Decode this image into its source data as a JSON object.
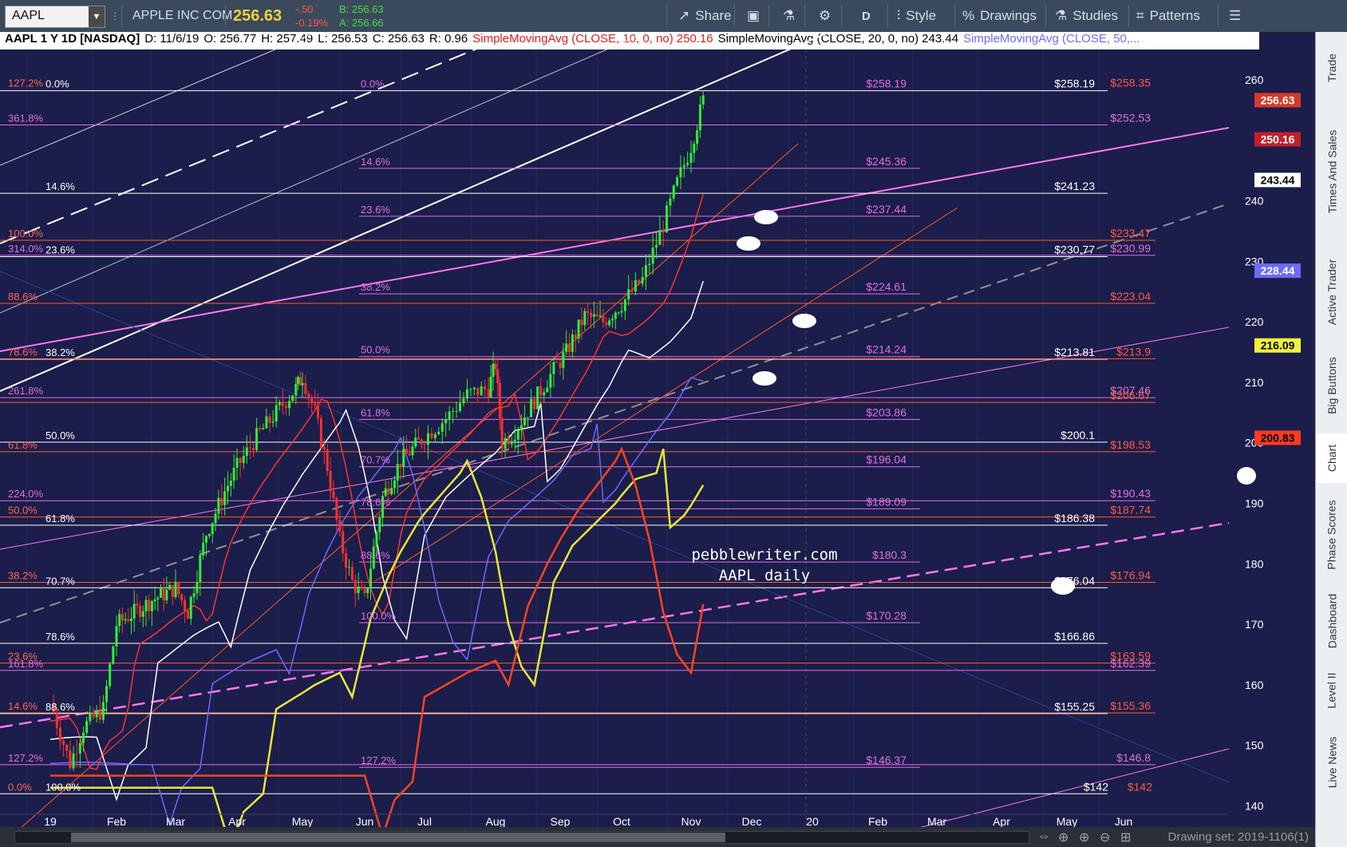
{
  "toolbar": {
    "symbol": "AAPL",
    "company": "APPLE INC COM",
    "last": "256.63",
    "change": "-.50",
    "change_pct": "-0.19%",
    "bid": "B: 256.63",
    "ask": "A: 256.66",
    "share_label": "Share",
    "period_label": "D",
    "style_label": "Style",
    "drawings_label": "Drawings",
    "studies_label": "Studies",
    "patterns_label": "Patterns"
  },
  "header": {
    "title": "AAPL 1 Y 1D [NASDAQ]",
    "date": "D: 11/6/19",
    "open": "O: 256.77",
    "high": "H: 257.49",
    "low": "L: 256.53",
    "close": "C: 256.63",
    "range": "R: 0.96",
    "sma10": "SimpleMovingAvg (CLOSE, 10, 0, no)",
    "sma10_val": "250.16",
    "sma20": "SimpleMovingAvg (CLOSE, 20, 0, no)",
    "sma20_val": "243.44",
    "sma50": "SimpleMovingAvg (CLOSE, 50,...",
    "colors": {
      "sma10": "#ff3333",
      "sma20": "#000000",
      "sma50": "#6b6bff"
    }
  },
  "watermark": [
    "pebblewriter.com",
    "AAPL daily"
  ],
  "right_tabs": [
    "Trade",
    "Times And Sales",
    "Active Trader",
    "Big Buttons",
    "Chart",
    "Phase Scores",
    "Dashboard",
    "Level II",
    "Live News"
  ],
  "active_tab": "Chart",
  "bottom": {
    "drawing_set": "Drawing set: 2019-1106(1)"
  },
  "chart_data": {
    "type": "candlestick",
    "ylim": [
      136.5,
      265
    ],
    "y_ticks": [
      140,
      150,
      160,
      170,
      180,
      190,
      200,
      210,
      220,
      230,
      240,
      260
    ],
    "x_ticks": [
      {
        "label": "19",
        "month": 0
      },
      {
        "label": "Feb",
        "month": 1
      },
      {
        "label": "Mar",
        "month": 2
      },
      {
        "label": "Apr",
        "month": 3
      },
      {
        "label": "May",
        "month": 4
      },
      {
        "label": "Jun",
        "month": 5
      },
      {
        "label": "Jul",
        "month": 6
      },
      {
        "label": "Aug",
        "month": 7
      },
      {
        "label": "Sep",
        "month": 8
      },
      {
        "label": "Oct",
        "month": 9
      },
      {
        "label": "Nov",
        "month": 10
      },
      {
        "label": "Dec",
        "month": 11
      },
      {
        "label": "20",
        "month": 12
      },
      {
        "label": "Feb",
        "month": 13
      },
      {
        "label": "Mar",
        "month": 14
      },
      {
        "label": "Apr",
        "month": 15
      },
      {
        "label": "May",
        "month": 16
      },
      {
        "label": "Jun",
        "month": 17
      }
    ],
    "price_path": [
      [
        0,
        157
      ],
      [
        0.3,
        147
      ],
      [
        0.5,
        153
      ],
      [
        0.8,
        156
      ],
      [
        1.0,
        170
      ],
      [
        1.3,
        172
      ],
      [
        1.6,
        174
      ],
      [
        2.0,
        176
      ],
      [
        2.2,
        172
      ],
      [
        2.5,
        185
      ],
      [
        2.8,
        192
      ],
      [
        3.0,
        196
      ],
      [
        3.3,
        201
      ],
      [
        3.6,
        205
      ],
      [
        3.9,
        209
      ],
      [
        4.0,
        211
      ],
      [
        4.2,
        205
      ],
      [
        4.4,
        196
      ],
      [
        4.6,
        184
      ],
      [
        4.8,
        177
      ],
      [
        5.0,
        174
      ],
      [
        5.3,
        191
      ],
      [
        5.6,
        197
      ],
      [
        6.0,
        201
      ],
      [
        6.3,
        204
      ],
      [
        6.6,
        208
      ],
      [
        6.9,
        209
      ],
      [
        7.0,
        213
      ],
      [
        7.1,
        200
      ],
      [
        7.3,
        202
      ],
      [
        7.6,
        207
      ],
      [
        7.9,
        212
      ],
      [
        8.1,
        215
      ],
      [
        8.4,
        221
      ],
      [
        8.7,
        220
      ],
      [
        9.0,
        223
      ],
      [
        9.3,
        227
      ],
      [
        9.6,
        236
      ],
      [
        9.8,
        243
      ],
      [
        10.0,
        249
      ],
      [
        10.2,
        256.6
      ]
    ],
    "moving_averages": [
      {
        "name": "SimpleMovingAvg (CLOSE, 10, 0, no)",
        "color": "#ff3333",
        "value": 250.16
      },
      {
        "name": "SimpleMovingAvg (CLOSE, 20, 0, no)",
        "color": "#ffffff",
        "value": 243.44
      },
      {
        "name": "SimpleMovingAvg (CLOSE, 50,...",
        "color": "#6b6bff",
        "value": 228.44
      },
      {
        "name": "",
        "color": "#e8e838",
        "value": 216.09
      },
      {
        "name": "",
        "color": "#ff4422",
        "value": 200.83
      }
    ],
    "price_badges": [
      {
        "value": 256.63,
        "label": "256.63",
        "bg": "#d53a2a",
        "fg": "#ffffff"
      },
      {
        "value": 250.16,
        "label": "250.16",
        "bg": "#c4202a",
        "fg": "#ffffff"
      },
      {
        "value": 243.44,
        "label": "243.44",
        "bg": "#ffffff",
        "fg": "#000000"
      },
      {
        "value": 228.44,
        "label": "228.44",
        "bg": "#6b6bff",
        "fg": "#ffffff"
      },
      {
        "value": 216.09,
        "label": "216.09",
        "bg": "#f2f23a",
        "fg": "#000000"
      },
      {
        "value": 200.83,
        "label": "200.83",
        "bg": "#ff3a22",
        "fg": "#000000"
      }
    ],
    "fib_levels": [
      {
        "price": 258.19,
        "color": "#ffffff",
        "x0": 0,
        "x1": 1388,
        "pct": "0.0%",
        "pct_x": 57,
        "right": "$258.19",
        "right_x": 1372
      },
      {
        "price": 258.35,
        "color": "#ffffff",
        "x0": 0,
        "x1": 0,
        "pct": "127.2%",
        "pct_x": 10,
        "pct_color": "#ff6655",
        "right": "$258.35",
        "right_x": 1442,
        "right_color": "#ff5a44"
      },
      {
        "price": 258.19,
        "color": "#e070e0",
        "x0": 0,
        "x1": 0,
        "pct": "0.0%",
        "pct_x": 452,
        "pct_color": "#e070e0",
        "right": "$258.19",
        "right_x": 1136,
        "right_color": "#e070e0"
      },
      {
        "price": 252.53,
        "color": "#e070e0",
        "x0": 0,
        "x1": 1388,
        "pct": "361.8%",
        "pct_x": 10,
        "pct_color": "#e070e0",
        "right": "$252.53",
        "right_x": 1442,
        "right_color": "#e070e0"
      },
      {
        "price": 245.36,
        "color": "#e070e0",
        "x0": 450,
        "x1": 1153,
        "pct": "14.6%",
        "pct_x": 452,
        "pct_color": "#e070e0",
        "right": "$245.36",
        "right_x": 1136,
        "right_color": "#e070e0"
      },
      {
        "price": 241.23,
        "color": "#ffffff",
        "x0": 0,
        "x1": 1388,
        "pct": "14.6%",
        "pct_x": 57,
        "right": "$241.23",
        "right_x": 1372
      },
      {
        "price": 237.44,
        "color": "#e070e0",
        "x0": 450,
        "x1": 1153,
        "pct": "23.6%",
        "pct_x": 452,
        "pct_color": "#e070e0",
        "right": "$237.44",
        "right_x": 1136,
        "right_color": "#e070e0"
      },
      {
        "price": 233.47,
        "color": "#ff5a2a",
        "x0": 0,
        "x1": 1448,
        "pct": "100.0%",
        "pct_x": 10,
        "pct_color": "#ff6655",
        "right": "$233.47",
        "right_x": 1442,
        "right_color": "#ff5a44"
      },
      {
        "price": 230.99,
        "color": "#e070e0",
        "x0": 0,
        "x1": 1448,
        "pct": "314.0%",
        "pct_x": 10,
        "pct_color": "#e070e0",
        "right": "$230.99",
        "right_x": 1442,
        "right_color": "#e070e0"
      },
      {
        "price": 230.77,
        "color": "#ffffff",
        "x0": 0,
        "x1": 1388,
        "pct": "23.6%",
        "pct_x": 57,
        "right": "$230.77",
        "right_x": 1372
      },
      {
        "price": 224.61,
        "color": "#e070e0",
        "x0": 450,
        "x1": 1153,
        "pct": "38.2%",
        "pct_x": 452,
        "pct_color": "#e070e0",
        "right": "$224.61",
        "right_x": 1136,
        "right_color": "#e070e0"
      },
      {
        "price": 223.04,
        "color": "#ff5a2a",
        "x0": 0,
        "x1": 1448,
        "pct": "88.6%",
        "pct_x": 10,
        "pct_color": "#ff6655",
        "right": "$223.04",
        "right_x": 1442,
        "right_color": "#ff5a44"
      },
      {
        "price": 214.24,
        "color": "#e070e0",
        "x0": 450,
        "x1": 1153,
        "pct": "50.0%",
        "pct_x": 452,
        "pct_color": "#e070e0",
        "right": "$214.24",
        "right_x": 1136,
        "right_color": "#e070e0"
      },
      {
        "price": 213.81,
        "color": "#ffffff",
        "x0": 0,
        "x1": 1388,
        "pct": "38.2%",
        "pct_x": 57,
        "right": "$213.81",
        "right_x": 1372
      },
      {
        "price": 213.9,
        "color": "#ff5a2a",
        "x0": 0,
        "x1": 1448,
        "pct": "78.6%",
        "pct_x": 10,
        "pct_color": "#ff6655",
        "right": "$213.9",
        "right_x": 1442,
        "right_color": "#ff5a44"
      },
      {
        "price": 207.46,
        "color": "#e070e0",
        "x0": 0,
        "x1": 1448,
        "pct": "261.8%",
        "pct_x": 10,
        "pct_color": "#e070e0",
        "right": "$207.46",
        "right_x": 1442,
        "right_color": "#e070e0"
      },
      {
        "price": 206.67,
        "color": "#ff5a2a",
        "x0": 0,
        "x1": 1448,
        "pct": "",
        "pct_x": 10,
        "right": "$206.67",
        "right_x": 1442,
        "right_color": "#ff5a44"
      },
      {
        "price": 203.86,
        "color": "#e070e0",
        "x0": 450,
        "x1": 1153,
        "pct": "61.8%",
        "pct_x": 452,
        "pct_color": "#e070e0",
        "right": "$203.86",
        "right_x": 1136,
        "right_color": "#e070e0"
      },
      {
        "price": 200.1,
        "color": "#ffffff",
        "x0": 0,
        "x1": 1388,
        "pct": "50.0%",
        "pct_x": 57,
        "right": "$200.1",
        "right_x": 1372
      },
      {
        "price": 198.53,
        "color": "#ff5a2a",
        "x0": 0,
        "x1": 1448,
        "pct": "61.8%",
        "pct_x": 10,
        "pct_color": "#ff6655",
        "right": "$198.53",
        "right_x": 1442,
        "right_color": "#ff5a44"
      },
      {
        "price": 196.04,
        "color": "#e070e0",
        "x0": 450,
        "x1": 1153,
        "pct": "70.7%",
        "pct_x": 452,
        "pct_color": "#e070e0",
        "right": "$196.04",
        "right_x": 1136,
        "right_color": "#e070e0"
      },
      {
        "price": 190.43,
        "color": "#e070e0",
        "x0": 0,
        "x1": 1448,
        "pct": "224.0%",
        "pct_x": 10,
        "pct_color": "#e070e0",
        "right": "$190.43",
        "right_x": 1442,
        "right_color": "#e070e0"
      },
      {
        "price": 189.09,
        "color": "#e070e0",
        "x0": 450,
        "x1": 1153,
        "pct": "78.6%",
        "pct_x": 452,
        "pct_color": "#e070e0",
        "right": "$189.09",
        "right_x": 1136,
        "right_color": "#e070e0"
      },
      {
        "price": 187.74,
        "color": "#ff5a2a",
        "x0": 0,
        "x1": 1448,
        "pct": "50.0%",
        "pct_x": 10,
        "pct_color": "#ff6655",
        "right": "$187.74",
        "right_x": 1442,
        "right_color": "#ff5a44"
      },
      {
        "price": 186.38,
        "color": "#ffffff",
        "x0": 0,
        "x1": 1388,
        "pct": "61.8%",
        "pct_x": 57,
        "right": "$186.38",
        "right_x": 1372
      },
      {
        "price": 180.3,
        "color": "#e070e0",
        "x0": 450,
        "x1": 1153,
        "pct": "88.6%",
        "pct_x": 452,
        "pct_color": "#e070e0",
        "right": "$180.3",
        "right_x": 1136,
        "right_color": "#e070e0"
      },
      {
        "price": 176.94,
        "color": "#ff5a2a",
        "x0": 0,
        "x1": 1448,
        "pct": "38.2%",
        "pct_x": 10,
        "pct_color": "#ff6655",
        "right": "$176.94",
        "right_x": 1442,
        "right_color": "#ff5a44"
      },
      {
        "price": 176.04,
        "color": "#ffffff",
        "x0": 0,
        "x1": 1388,
        "pct": "70.7%",
        "pct_x": 57,
        "right": "$176.04",
        "right_x": 1372
      },
      {
        "price": 170.28,
        "color": "#e070e0",
        "x0": 450,
        "x1": 1153,
        "pct": "100.0%",
        "pct_x": 452,
        "pct_color": "#e070e0",
        "right": "$170.28",
        "right_x": 1136,
        "right_color": "#e070e0"
      },
      {
        "price": 166.86,
        "color": "#ffffff",
        "x0": 0,
        "x1": 1388,
        "pct": "78.6%",
        "pct_x": 57,
        "right": "$166.86",
        "right_x": 1372
      },
      {
        "price": 163.59,
        "color": "#ff5a2a",
        "x0": 0,
        "x1": 1448,
        "pct": "23.6%",
        "pct_x": 10,
        "pct_color": "#ff6655",
        "right": "$163.59",
        "right_x": 1442,
        "right_color": "#ff5a44"
      },
      {
        "price": 162.39,
        "color": "#e070e0",
        "x0": 0,
        "x1": 1448,
        "pct": "161.8%",
        "pct_x": 10,
        "pct_color": "#e070e0",
        "right": "$162.39",
        "right_x": 1442,
        "right_color": "#e070e0"
      },
      {
        "price": 155.36,
        "color": "#ff5a2a",
        "x0": 0,
        "x1": 1448,
        "pct": "14.6%",
        "pct_x": 10,
        "pct_color": "#ff6655",
        "right": "$155.36",
        "right_x": 1442,
        "right_color": "#ff5a44"
      },
      {
        "price": 155.25,
        "color": "#ffffff",
        "x0": 0,
        "x1": 1388,
        "pct": "88.6%",
        "pct_x": 57,
        "right": "$155.25",
        "right_x": 1372
      },
      {
        "price": 146.8,
        "color": "#e070e0",
        "x0": 0,
        "x1": 1448,
        "pct": "127.2%",
        "pct_x": 10,
        "pct_color": "#e070e0",
        "right": "$146.8",
        "right_x": 1442,
        "right_color": "#e070e0"
      },
      {
        "price": 146.37,
        "color": "#e070e0",
        "x0": 450,
        "x1": 1153,
        "pct": "127.2%",
        "pct_x": 452,
        "pct_color": "#e070e0",
        "right": "$146.37",
        "right_x": 1136,
        "right_color": "#e070e0"
      },
      {
        "price": 142,
        "color": "#ffffff",
        "x0": 0,
        "x1": 1388,
        "pct": "100.0%",
        "pct_x": 57,
        "right": "$142",
        "right_x": 1389
      },
      {
        "price": 142,
        "color": "#ff5a2a",
        "x0": 0,
        "x1": 0,
        "pct": "0.0%",
        "pct_x": 10,
        "pct_color": "#ff6655",
        "right": "$142",
        "right_x": 1444,
        "right_color": "#ff5a44"
      }
    ]
  }
}
